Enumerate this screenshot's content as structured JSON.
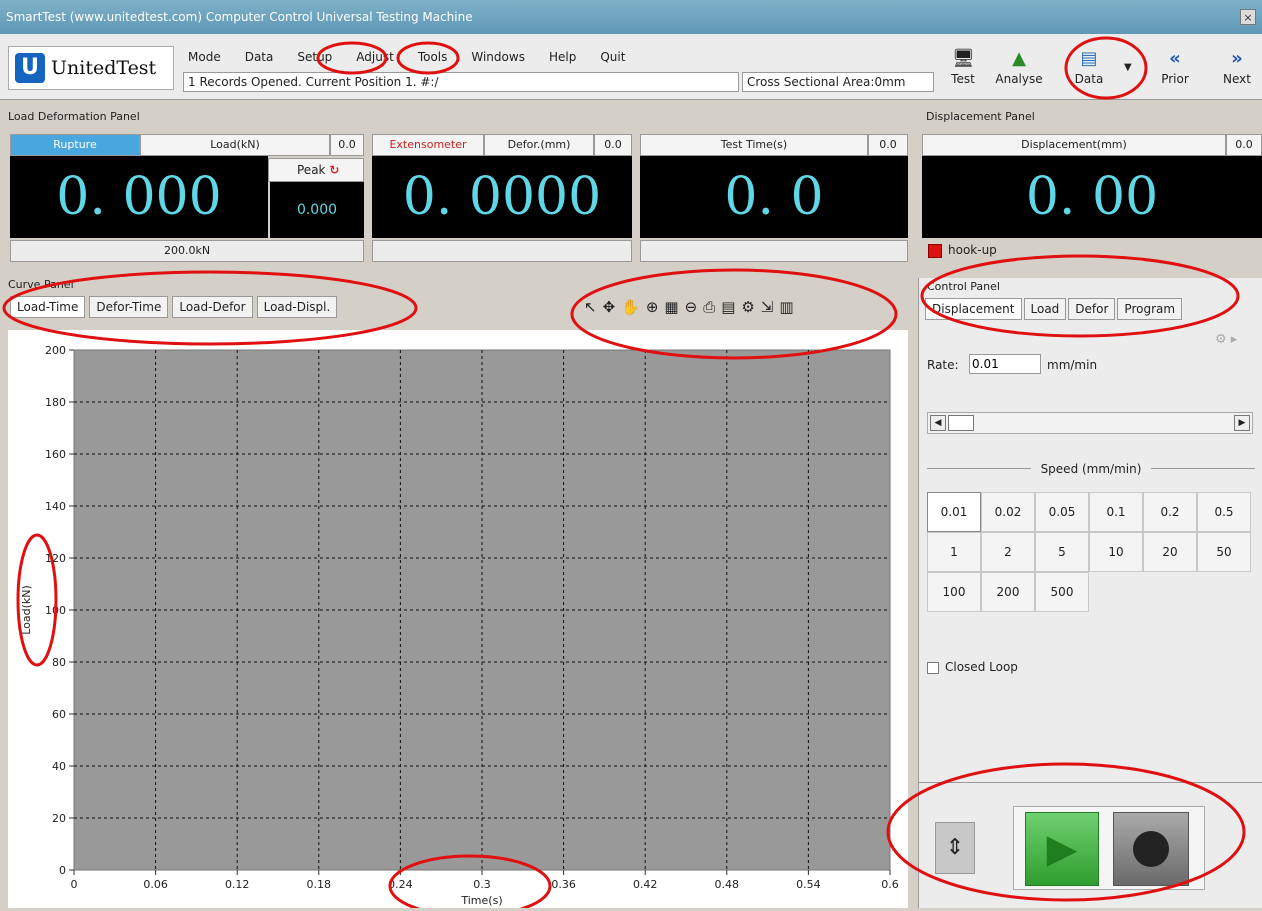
{
  "window": {
    "title": "SmartTest (www.unitedtest.com) Computer Control Universal Testing Machine",
    "close_glyph": "×"
  },
  "logo": {
    "text": "UnitedTest",
    "mark": "U"
  },
  "menu": [
    "Mode",
    "Data",
    "Setup",
    "Adjust",
    "Tools",
    "Windows",
    "Help",
    "Quit"
  ],
  "status": {
    "records": "1 Records Opened. Current Position 1. #:/",
    "area": "Cross Sectional Area:0mm"
  },
  "toolbar": [
    {
      "label": "Test",
      "icon": "monitor-icon"
    },
    {
      "label": "Analyse",
      "icon": "chart-icon"
    },
    {
      "label": "Data",
      "icon": "data-icon"
    },
    {
      "label": "Prior",
      "icon": "double-left-icon"
    },
    {
      "label": "Next",
      "icon": "double-right-icon"
    }
  ],
  "load_panel": {
    "title": "Load Deformation Panel",
    "rupture": "Rupture",
    "load_label": "Load(kN)",
    "load_small": "0.0",
    "load_value": "0. 000",
    "peak_label": "Peak",
    "peak_value": "0.000",
    "capacity": "200.0kN",
    "extensometer": "Extensometer",
    "defor_label": "Defor.(mm)",
    "defor_small": "0.0",
    "defor_value": "0. 0000",
    "time_label": "Test Time(s)",
    "time_small": "0.0",
    "time_value": "0. 0"
  },
  "displacement_panel": {
    "title": "Displacement Panel",
    "label": "Displacement(mm)",
    "small": "0.0",
    "value": "0. 00",
    "hookup": "hook-up"
  },
  "curve_panel": {
    "title": "Curve Panel",
    "tabs": [
      "Load-Time",
      "Defor-Time",
      "Load-Defor",
      "Load-Displ."
    ]
  },
  "chart_data": {
    "type": "line",
    "xlabel": "Time(s)",
    "ylabel": "Load(kN)",
    "xlim": [
      0,
      0.6
    ],
    "ylim": [
      0,
      200
    ],
    "xticks": [
      "0",
      "0.06",
      "0.12",
      "0.18",
      "0.24",
      "0.3",
      "0.36",
      "0.42",
      "0.48",
      "0.54",
      "0.6"
    ],
    "yticks": [
      "0",
      "20",
      "40",
      "60",
      "80",
      "100",
      "120",
      "140",
      "160",
      "180",
      "200"
    ],
    "grid": true,
    "series": []
  },
  "control_panel": {
    "title": "Control Panel",
    "tabs": [
      "Displacement",
      "Load",
      "Defor",
      "Program"
    ],
    "rate_label": "Rate:",
    "rate_value": "0.01",
    "rate_unit": "mm/min",
    "speed_title": "Speed (mm/min)",
    "speeds": [
      "0.01",
      "0.02",
      "0.05",
      "0.1",
      "0.2",
      "0.5",
      "1",
      "2",
      "5",
      "10",
      "20",
      "50",
      "100",
      "200",
      "500"
    ],
    "closed_loop": "Closed Loop"
  },
  "colors": {
    "accent": "#4aa6df",
    "lcd_text": "#5fd7e6",
    "annotation": "#e01010",
    "start": "#3bb33b"
  }
}
